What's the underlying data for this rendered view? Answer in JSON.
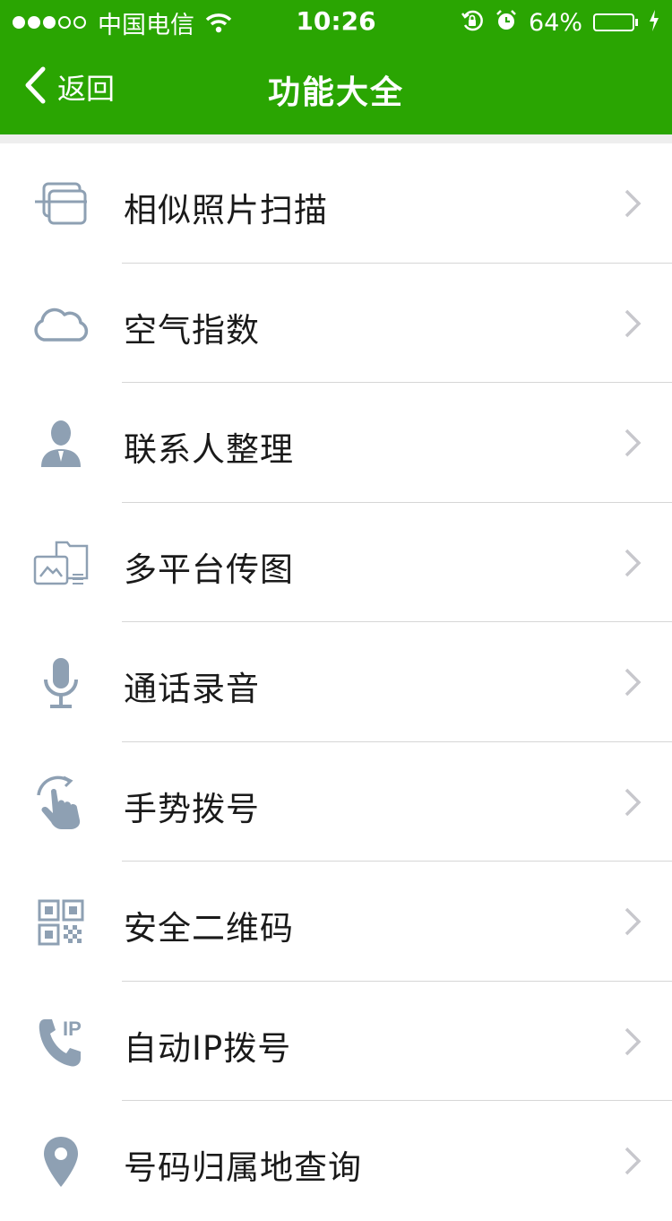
{
  "status_bar": {
    "carrier": "中国电信",
    "time": "10:26",
    "battery": "64%",
    "battery_level": 0.64
  },
  "nav": {
    "back_label": "返回",
    "title": "功能大全"
  },
  "items": [
    {
      "label": "相似照片扫描",
      "icon": "photo-scan-icon"
    },
    {
      "label": "空气指数",
      "icon": "cloud-icon"
    },
    {
      "label": "联系人整理",
      "icon": "contact-person-icon"
    },
    {
      "label": "多平台传图",
      "icon": "image-upload-icon"
    },
    {
      "label": "通话录音",
      "icon": "microphone-icon"
    },
    {
      "label": "手势拨号",
      "icon": "gesture-hand-icon"
    },
    {
      "label": "安全二维码",
      "icon": "qr-code-icon"
    },
    {
      "label": "自动IP拨号",
      "icon": "phone-ip-icon"
    },
    {
      "label": "号码归属地查询",
      "icon": "location-pin-icon"
    }
  ],
  "colors": {
    "header": "#2aa502",
    "icon": "#8ea0b3",
    "chevron": "#c7c7cc"
  }
}
